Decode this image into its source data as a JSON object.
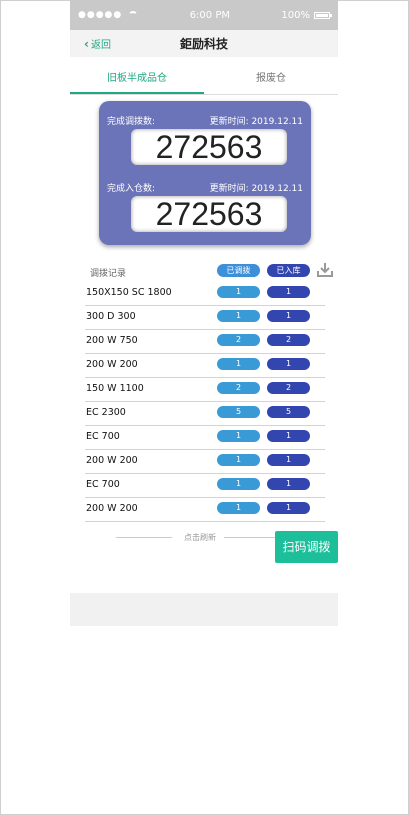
{
  "status_bar": {
    "signal": "●●●●●",
    "time": "6:00 PM",
    "battery_pct": "100%"
  },
  "nav": {
    "back_label": "返回",
    "title": "鉅励科技"
  },
  "tabs": [
    {
      "label": "旧板半成品仓",
      "active": true
    },
    {
      "label": "报废仓",
      "active": false
    }
  ],
  "summary": {
    "transfer_label": "完成调拨数:",
    "transfer_updated": "更新时间: 2019.12.11",
    "transfer_value": "272563",
    "stockin_label": "完成入仓数:",
    "stockin_updated": "更新时间: 2019.12.11",
    "stockin_value": "272563"
  },
  "records": {
    "title": "调拨记录",
    "col_transferred": "已调拨",
    "col_stocked": "已入库",
    "download_icon": "download-icon",
    "rows": [
      {
        "name": "150X150 SC 1800",
        "transferred": "1",
        "stocked": "1"
      },
      {
        "name": "300 D 300",
        "transferred": "1",
        "stocked": "1"
      },
      {
        "name": "200 W 750",
        "transferred": "2",
        "stocked": "2"
      },
      {
        "name": "200 W 200",
        "transferred": "1",
        "stocked": "1"
      },
      {
        "name": "150 W 1100",
        "transferred": "2",
        "stocked": "2"
      },
      {
        "name": "EC 2300",
        "transferred": "5",
        "stocked": "5"
      },
      {
        "name": "EC 700",
        "transferred": "1",
        "stocked": "1"
      },
      {
        "name": "200 W 200",
        "transferred": "1",
        "stocked": "1"
      },
      {
        "name": "EC 700",
        "transferred": "1",
        "stocked": "1"
      },
      {
        "name": "200 W 200",
        "transferred": "1",
        "stocked": "1"
      }
    ]
  },
  "refresh_label": "点击刷新",
  "scan_button": "扫码调拨",
  "colors": {
    "accent": "#1fa882",
    "card": "#6b74b9",
    "pill_transferred": "#3a9ad6",
    "pill_stocked": "#3346b0",
    "scan_button": "#1dbf9b"
  }
}
